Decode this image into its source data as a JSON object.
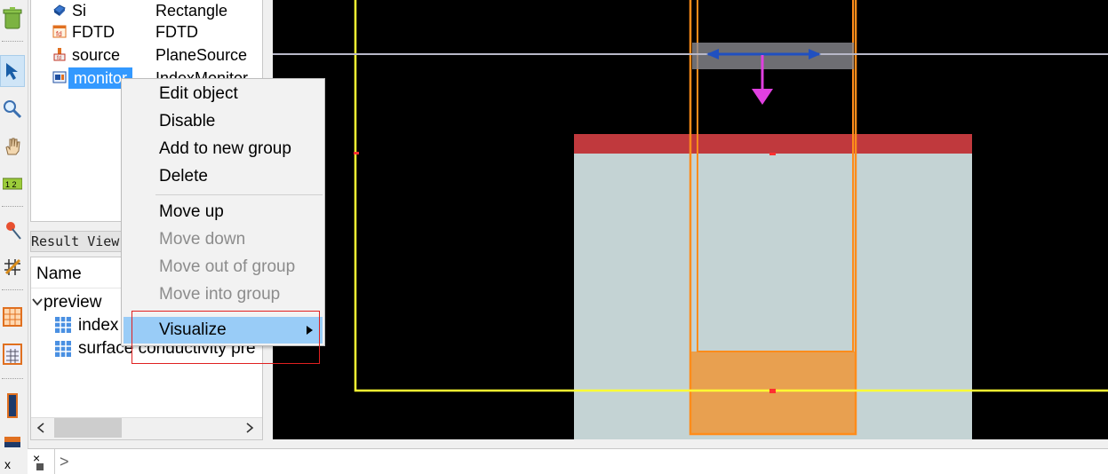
{
  "object_tree": {
    "rows": [
      {
        "name": "Si",
        "type": "Rectangle",
        "icon": "rectangle-icon"
      },
      {
        "name": "FDTD",
        "type": "FDTD",
        "icon": "fdtd-icon"
      },
      {
        "name": "source",
        "type": "PlaneSource",
        "icon": "source-icon"
      },
      {
        "name": "monitor",
        "type": "IndexMonitor",
        "icon": "monitor-icon"
      }
    ]
  },
  "result_view": {
    "tab_label": "Result View",
    "column_name": "Name",
    "group": "preview",
    "items": [
      "index",
      "surface conductivity pre"
    ]
  },
  "context_menu": {
    "items": [
      {
        "label": "Edit object",
        "enabled": true
      },
      {
        "label": "Disable",
        "enabled": true
      },
      {
        "label": "Add to new group",
        "enabled": true
      },
      {
        "label": "Delete",
        "enabled": true
      },
      {
        "label": "Move up",
        "enabled": true
      },
      {
        "label": "Move down",
        "enabled": false
      },
      {
        "label": "Move out of group",
        "enabled": false
      },
      {
        "label": "Move into group",
        "enabled": false
      },
      {
        "label": "Visualize",
        "enabled": true,
        "submenu": true,
        "highlighted": true
      }
    ]
  },
  "toolbar": {
    "icons": [
      "trash-icon",
      "select-arrow-icon",
      "zoom-icon",
      "pan-hand-icon",
      "ruler-icon",
      "pin-icon",
      "grid-edit-icon",
      "mesh-icon",
      "calculator-icon",
      "rect-tall-icon",
      "rect-flat-icon",
      "x-icon"
    ],
    "x_label": "x"
  },
  "console": {
    "close_label": "×",
    "prompt": ">"
  },
  "colors": {
    "viewport_bg": "#000000",
    "fdtd_region": "#ffff33",
    "monitor_outline": "#ff8c1a",
    "substrate": "#c4d3d4",
    "film": "#c0393d",
    "source_arrow": "#e040e0",
    "pol_arrow": "#2050c0",
    "menu_highlight": "#99ccf7",
    "annotation_box": "#e02020"
  }
}
